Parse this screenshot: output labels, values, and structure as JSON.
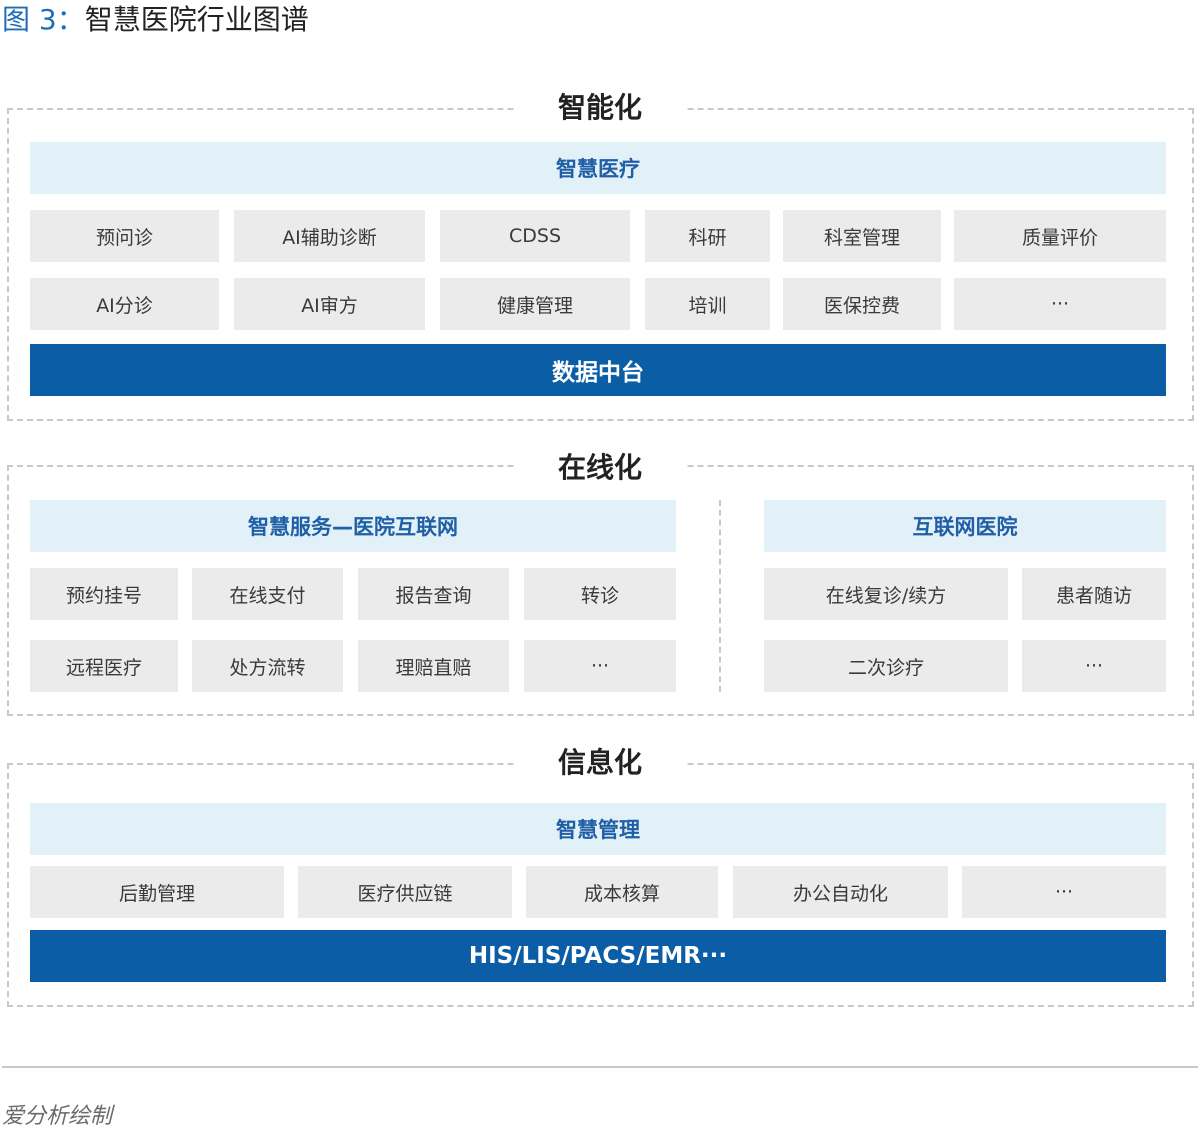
{
  "figure": {
    "label": "图 3：",
    "title": "智慧医院行业图谱"
  },
  "layers": {
    "intelligent": {
      "title": "智能化",
      "banner": "智慧医疗",
      "row1": [
        "预问诊",
        "AI辅助诊断",
        "CDSS",
        "科研",
        "科室管理",
        "质量评价"
      ],
      "row2": [
        "AI分诊",
        "AI审方",
        "健康管理",
        "培训",
        "医保控费",
        "···"
      ],
      "platform": "数据中台"
    },
    "online": {
      "title": "在线化",
      "left_banner": "智慧服务—医院互联网",
      "left_row1": [
        "预约挂号",
        "在线支付",
        "报告查询",
        "转诊"
      ],
      "left_row2": [
        "远程医疗",
        "处方流转",
        "理赔直赔",
        "···"
      ],
      "right_banner": "互联网医院",
      "right_row1": [
        "在线复诊/续方",
        "患者随访"
      ],
      "right_row2": [
        "二次诊疗",
        "···"
      ]
    },
    "informatized": {
      "title": "信息化",
      "banner": "智慧管理",
      "row1": [
        "后勤管理",
        "医疗供应链",
        "成本核算",
        "办公自动化",
        "···"
      ],
      "platform": "HIS/LIS/PACS/EMR···"
    }
  },
  "source": "爱分析绘制",
  "colors": {
    "accent_blue": "#0b5ea6",
    "banner_bg": "#e2f0f8",
    "banner_text": "#1f5fa6",
    "cell_bg": "#ebebeb",
    "border": "#c8c8c8"
  }
}
